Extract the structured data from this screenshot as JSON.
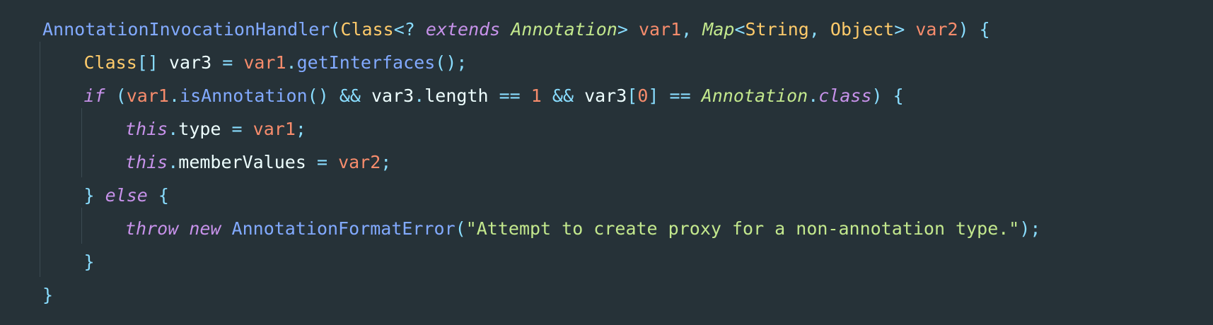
{
  "editor": {
    "language": "java",
    "theme": {
      "background": "#263238",
      "indent_guide": "#3b4a52"
    },
    "lines": [
      {
        "indent": 0,
        "tokens": [
          {
            "text": "AnnotationInvocationHandler",
            "color": "#82AAFF"
          },
          {
            "text": "(",
            "color": "#89DDFF"
          },
          {
            "text": "Class",
            "color": "#FFCB6B"
          },
          {
            "text": "<?",
            "color": "#89DDFF"
          },
          {
            "text": " ",
            "color": "#EEFFFF"
          },
          {
            "text": "extends",
            "color": "#C792EA",
            "italic": true
          },
          {
            "text": " ",
            "color": "#EEFFFF"
          },
          {
            "text": "Annotation",
            "color": "#C3E88D",
            "italic": true
          },
          {
            "text": ">",
            "color": "#89DDFF"
          },
          {
            "text": " ",
            "color": "#EEFFFF"
          },
          {
            "text": "var1",
            "color": "#F78C6C"
          },
          {
            "text": ", ",
            "color": "#89DDFF"
          },
          {
            "text": "Map",
            "color": "#C3E88D",
            "italic": true
          },
          {
            "text": "<",
            "color": "#89DDFF"
          },
          {
            "text": "String",
            "color": "#FFCB6B"
          },
          {
            "text": ", ",
            "color": "#89DDFF"
          },
          {
            "text": "Object",
            "color": "#FFCB6B"
          },
          {
            "text": ">",
            "color": "#89DDFF"
          },
          {
            "text": " ",
            "color": "#EEFFFF"
          },
          {
            "text": "var2",
            "color": "#F78C6C"
          },
          {
            "text": ") {",
            "color": "#89DDFF"
          }
        ]
      },
      {
        "indent": 1,
        "tokens": [
          {
            "text": "Class",
            "color": "#FFCB6B"
          },
          {
            "text": "[]",
            "color": "#89DDFF"
          },
          {
            "text": " var3 ",
            "color": "#EEFFFF"
          },
          {
            "text": "=",
            "color": "#89DDFF"
          },
          {
            "text": " ",
            "color": "#EEFFFF"
          },
          {
            "text": "var1",
            "color": "#F78C6C"
          },
          {
            "text": ".",
            "color": "#89DDFF"
          },
          {
            "text": "getInterfaces",
            "color": "#82AAFF"
          },
          {
            "text": "();",
            "color": "#89DDFF"
          }
        ]
      },
      {
        "indent": 1,
        "tokens": [
          {
            "text": "if",
            "color": "#C792EA",
            "italic": true
          },
          {
            "text": " ",
            "color": "#EEFFFF"
          },
          {
            "text": "(",
            "color": "#89DDFF"
          },
          {
            "text": "var1",
            "color": "#F78C6C"
          },
          {
            "text": ".",
            "color": "#89DDFF"
          },
          {
            "text": "isAnnotation",
            "color": "#82AAFF"
          },
          {
            "text": "()",
            "color": "#89DDFF"
          },
          {
            "text": " ",
            "color": "#EEFFFF"
          },
          {
            "text": "&&",
            "color": "#89DDFF"
          },
          {
            "text": " var3",
            "color": "#EEFFFF"
          },
          {
            "text": ".",
            "color": "#89DDFF"
          },
          {
            "text": "length ",
            "color": "#EEFFFF"
          },
          {
            "text": "==",
            "color": "#89DDFF"
          },
          {
            "text": " ",
            "color": "#EEFFFF"
          },
          {
            "text": "1",
            "color": "#F78C6C"
          },
          {
            "text": " ",
            "color": "#EEFFFF"
          },
          {
            "text": "&&",
            "color": "#89DDFF"
          },
          {
            "text": " var3",
            "color": "#EEFFFF"
          },
          {
            "text": "[",
            "color": "#89DDFF"
          },
          {
            "text": "0",
            "color": "#F78C6C"
          },
          {
            "text": "]",
            "color": "#89DDFF"
          },
          {
            "text": " ",
            "color": "#EEFFFF"
          },
          {
            "text": "==",
            "color": "#89DDFF"
          },
          {
            "text": " ",
            "color": "#EEFFFF"
          },
          {
            "text": "Annotation",
            "color": "#C3E88D",
            "italic": true
          },
          {
            "text": ".",
            "color": "#89DDFF"
          },
          {
            "text": "class",
            "color": "#C792EA",
            "italic": true
          },
          {
            "text": ") {",
            "color": "#89DDFF"
          }
        ]
      },
      {
        "indent": 2,
        "tokens": [
          {
            "text": "this",
            "color": "#C792EA",
            "italic": true
          },
          {
            "text": ".",
            "color": "#89DDFF"
          },
          {
            "text": "type ",
            "color": "#EEFFFF"
          },
          {
            "text": "=",
            "color": "#89DDFF"
          },
          {
            "text": " ",
            "color": "#EEFFFF"
          },
          {
            "text": "var1",
            "color": "#F78C6C"
          },
          {
            "text": ";",
            "color": "#89DDFF"
          }
        ]
      },
      {
        "indent": 2,
        "tokens": [
          {
            "text": "this",
            "color": "#C792EA",
            "italic": true
          },
          {
            "text": ".",
            "color": "#89DDFF"
          },
          {
            "text": "memberValues ",
            "color": "#EEFFFF"
          },
          {
            "text": "=",
            "color": "#89DDFF"
          },
          {
            "text": " ",
            "color": "#EEFFFF"
          },
          {
            "text": "var2",
            "color": "#F78C6C"
          },
          {
            "text": ";",
            "color": "#89DDFF"
          }
        ]
      },
      {
        "indent": 1,
        "tokens": [
          {
            "text": "}",
            "color": "#89DDFF"
          },
          {
            "text": " ",
            "color": "#EEFFFF"
          },
          {
            "text": "else",
            "color": "#C792EA",
            "italic": true
          },
          {
            "text": " {",
            "color": "#89DDFF"
          }
        ]
      },
      {
        "indent": 2,
        "tokens": [
          {
            "text": "throw",
            "color": "#C792EA",
            "italic": true
          },
          {
            "text": " ",
            "color": "#EEFFFF"
          },
          {
            "text": "new",
            "color": "#C792EA",
            "italic": true
          },
          {
            "text": " ",
            "color": "#EEFFFF"
          },
          {
            "text": "AnnotationFormatError",
            "color": "#82AAFF"
          },
          {
            "text": "(",
            "color": "#89DDFF"
          },
          {
            "text": "\"Attempt to create proxy for a non-annotation type.\"",
            "color": "#C3E88D"
          },
          {
            "text": ");",
            "color": "#89DDFF"
          }
        ]
      },
      {
        "indent": 1,
        "tokens": [
          {
            "text": "}",
            "color": "#89DDFF"
          }
        ]
      },
      {
        "indent": 0,
        "tokens": [
          {
            "text": "}",
            "color": "#89DDFF"
          }
        ]
      }
    ],
    "indent_guides": [
      {
        "level": 1,
        "from_line": 1,
        "to_line": 7
      },
      {
        "level": 2,
        "from_line": 3,
        "to_line": 4
      },
      {
        "level": 2,
        "from_line": 6,
        "to_line": 6
      }
    ]
  }
}
